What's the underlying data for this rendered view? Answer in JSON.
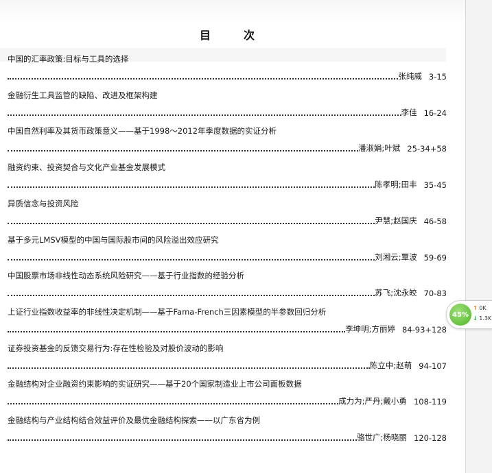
{
  "toc": {
    "title": "目　次",
    "entries": [
      {
        "title": "中国的汇率政策:目标与工具的选择",
        "author": "张纯威",
        "pages": "3-15"
      },
      {
        "title": "金融衍生工具监管的缺陷、改进及框架构建",
        "author": "李佳",
        "pages": "16-24"
      },
      {
        "title": "中国自然利率及其货币政策意义——基于1998～2012年季度数据的实证分析",
        "author": "潘淑娟;叶斌",
        "pages": "25-34+58"
      },
      {
        "title": "融资约束、投资契合与文化产业基金发展模式",
        "author": "陈孝明;田丰",
        "pages": "35-45"
      },
      {
        "title": "异质信念与投资风险",
        "author": "尹慧;赵国庆",
        "pages": "46-58"
      },
      {
        "title": "基于多元LMSV模型的中国与国际股市间的风险溢出效应研究",
        "author": "刘湘云;覃波",
        "pages": "59-69"
      },
      {
        "title": "中国股票市场非线性动态系统风险研究——基于行业指数的经验分析",
        "author": "苏飞;沈永皎",
        "pages": "70-83"
      },
      {
        "title": "上证行业指数收益率的非线性决定机制——基于Fama-French三因素模型的半参数回归分析",
        "author": "李坤明;方丽婷",
        "pages": "84-93+128"
      },
      {
        "title": "证券投资基金的反馈交易行为:存在性检验及对股价波动的影响",
        "author": "陈立中;赵萌",
        "pages": "94-107"
      },
      {
        "title": "金融结构对企业融资约束影响的实证研究——基于20个国家制造业上市公司面板数据",
        "author": "成力为;严丹;戴小勇",
        "pages": "108-119"
      },
      {
        "title": "金融结构与产业结构结合效益评价及最优金融结构探索——以广东省为例",
        "author": "骆世广;杨晓丽",
        "pages": "120-128"
      }
    ]
  },
  "widget": {
    "percent": "45%",
    "upload": "0K",
    "download": "1.3K",
    "up_arrow": "↑",
    "down_arrow": "↓"
  }
}
